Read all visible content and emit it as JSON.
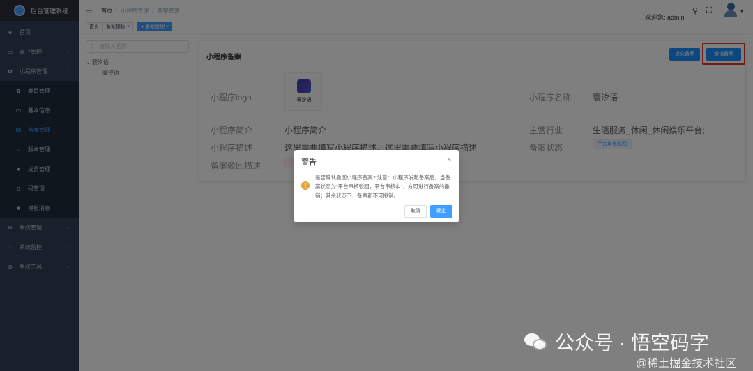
{
  "sidebar": {
    "app_title": "后台管理系统",
    "items": [
      {
        "label": "首页",
        "icon": "dashboard-icon"
      },
      {
        "label": "商户管理",
        "icon": "shop-icon"
      },
      {
        "label": "小程序管理",
        "icon": "miniprogram-icon"
      },
      {
        "label": "系统管理",
        "icon": "gear-icon"
      },
      {
        "label": "系统监控",
        "icon": "monitor-icon"
      },
      {
        "label": "系统工具",
        "icon": "tool-icon"
      }
    ],
    "subitems": [
      {
        "label": "类目管理",
        "icon": "category-icon"
      },
      {
        "label": "基本信息",
        "icon": "info-icon"
      },
      {
        "label": "备案管理",
        "icon": "record-icon"
      },
      {
        "label": "版本管理",
        "icon": "code-icon"
      },
      {
        "label": "成员管理",
        "icon": "user-icon"
      },
      {
        "label": "码管理",
        "icon": "qrcode-icon"
      },
      {
        "label": "模板消息",
        "icon": "message-icon"
      }
    ]
  },
  "navbar": {
    "breadcrumb": [
      "首页",
      "小程序管理",
      "备案管理"
    ],
    "welcome": "欢迎您: admin"
  },
  "tags": [
    "首页",
    "备案模板",
    "备案管理"
  ],
  "tree": {
    "search_placeholder": "请输入名称",
    "root": "寰汐语",
    "child": "寰汐语"
  },
  "card": {
    "title": "小程序备案",
    "btn_apply": "提交备案",
    "btn_revoke": "撤销备案",
    "logo_label": "小程序logo",
    "logo_caption": "寰汐语",
    "name_label": "小程序名称",
    "name_value": "寰汐语",
    "intro_label": "小程序简介",
    "intro_value": "小程序简介",
    "industry_label": "主营行业",
    "industry_value": "生活服务_休闲_休闲娱乐平台;",
    "desc_label": "小程序描述",
    "desc_value": "这里需要填写小程序描述，这里需要填写小程序描述",
    "status_label": "备案状态",
    "status_value": "平台审核驳回",
    "reason_label": "备案驳回描述"
  },
  "dialog": {
    "title": "警告",
    "message": "是否确认撤回小程序备案? 注意：小程序发起备案后，当备案状态为\"平台审核驳回，平台审核中\"，方可进行备案的撤销；其余状态下，备案都不可撤销。",
    "cancel": "取消",
    "ok": "确定"
  },
  "watermark": {
    "main": "公众号 · 悟空码字",
    "sub": "@稀土掘金技术社区"
  }
}
